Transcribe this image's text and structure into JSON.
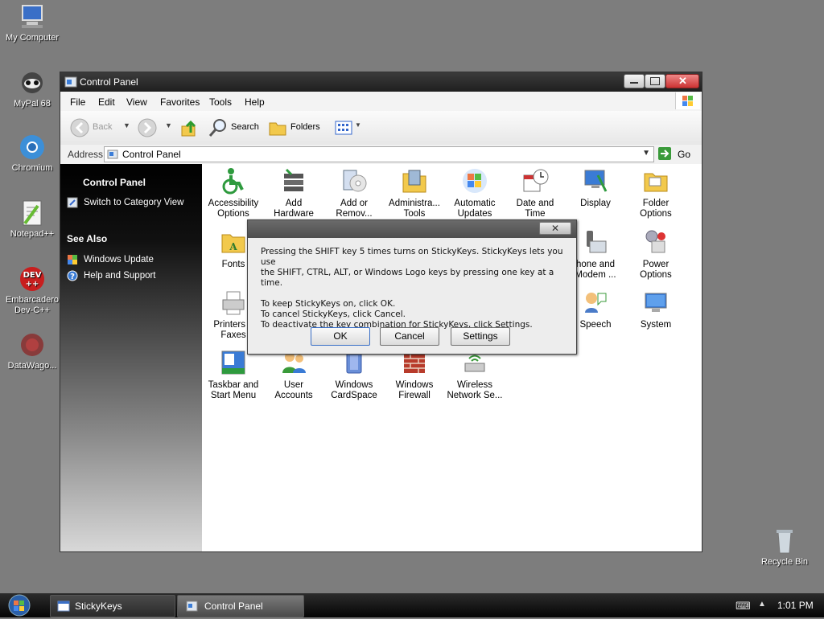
{
  "desktop": {
    "icons": [
      {
        "label": "My Computer"
      },
      {
        "label": "MyPal 68"
      },
      {
        "label": "Chromium"
      },
      {
        "label": "Notepad++"
      },
      {
        "label": "Embarcadero Dev-C++"
      },
      {
        "label": "DataWago..."
      },
      {
        "label": "Recycle Bin"
      }
    ]
  },
  "window": {
    "title": "Control Panel",
    "menu": [
      "File",
      "Edit",
      "View",
      "Favorites",
      "Tools",
      "Help"
    ],
    "toolbar": {
      "back": "Back",
      "search": "Search",
      "folders": "Folders"
    },
    "address": {
      "label": "Address",
      "value": "Control Panel",
      "go": "Go"
    },
    "sidebar": {
      "section_title": "Control Panel",
      "switch_view": "Switch to Category View",
      "see_also": "See Also",
      "links": [
        "Windows Update",
        "Help and Support"
      ]
    },
    "items": [
      {
        "l1": "Accessibility",
        "l2": "Options"
      },
      {
        "l1": "Add",
        "l2": "Hardware"
      },
      {
        "l1": "Add or",
        "l2": "Remov..."
      },
      {
        "l1": "Administra...",
        "l2": "Tools"
      },
      {
        "l1": "Automatic",
        "l2": "Updates"
      },
      {
        "l1": "Date and",
        "l2": "Time"
      },
      {
        "l1": "Display",
        "l2": ""
      },
      {
        "l1": "Folder",
        "l2": "Options"
      },
      {
        "l1": "Fonts",
        "l2": ""
      },
      {
        "l1": "hone and",
        "l2": "Modem ..."
      },
      {
        "l1": "Power",
        "l2": "Options"
      },
      {
        "l1": "Printers a",
        "l2": "Faxes"
      },
      {
        "l1": "Speech",
        "l2": ""
      },
      {
        "l1": "System",
        "l2": ""
      },
      {
        "l1": "Taskbar and",
        "l2": "Start Menu"
      },
      {
        "l1": "User",
        "l2": "Accounts"
      },
      {
        "l1": "Windows",
        "l2": "CardSpace"
      },
      {
        "l1": "Windows",
        "l2": "Firewall"
      },
      {
        "l1": "Wireless",
        "l2": "Network Se..."
      }
    ]
  },
  "dialog": {
    "line1": "Pressing the SHIFT key 5 times turns on StickyKeys. StickyKeys lets you use",
    "line2": "the SHIFT, CTRL, ALT, or Windows Logo keys by pressing one key at a time.",
    "line3": "To keep StickyKeys on, click OK.",
    "line4": "To cancel StickyKeys, click Cancel.",
    "line5": "To deactivate the key combination for StickyKeys, click Settings.",
    "ok": "OK",
    "cancel": "Cancel",
    "settings": "Settings"
  },
  "taskbar": {
    "tasks": [
      "StickyKeys",
      "Control Panel"
    ],
    "clock": "1:01 PM"
  },
  "colors": {
    "selection_bg": "#000000",
    "title_bg": "#2a2a2a",
    "sidebar_text": "#ffffff"
  }
}
